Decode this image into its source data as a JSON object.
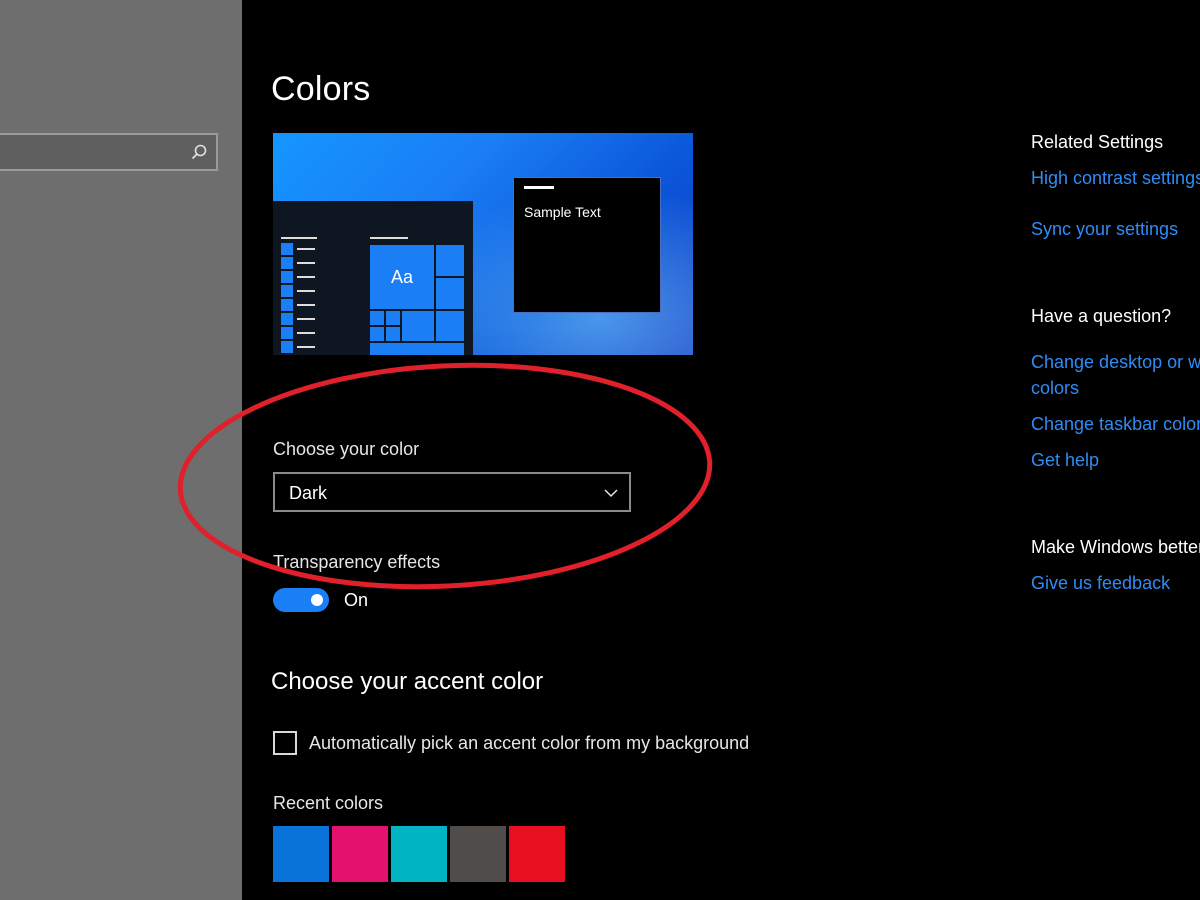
{
  "sidebar": {
    "search": {
      "placeholder": "",
      "value": ""
    }
  },
  "page": {
    "title": "Colors"
  },
  "preview": {
    "tile_label": "Aa",
    "sample_text": "Sample Text"
  },
  "color_mode": {
    "label": "Choose your color",
    "selected": "Dark"
  },
  "transparency": {
    "label": "Transparency effects",
    "state": "On",
    "enabled": true
  },
  "accent": {
    "heading": "Choose your accent color",
    "auto_pick_label": "Automatically pick an accent color from my background",
    "auto_pick_checked": false,
    "recent_label": "Recent colors",
    "recent_colors": [
      "#0a73d9",
      "#e3126f",
      "#00b4c3",
      "#4f4c49",
      "#e7101f"
    ]
  },
  "right_panel": {
    "related_heading": "Related Settings",
    "high_contrast_link": "High contrast settings",
    "sync_link": "Sync your settings",
    "question_heading": "Have a question?",
    "change_desktop_link_line1": "Change desktop or window",
    "change_desktop_link_line2": "colors",
    "change_taskbar_link": "Change taskbar color",
    "get_help_link": "Get help",
    "make_better_heading": "Make Windows better",
    "feedback_link": "Give us feedback"
  },
  "colors": {
    "accent_blue": "#1a7ef5",
    "link_blue": "#2f8cf5",
    "annotation_red": "#e0202a"
  }
}
